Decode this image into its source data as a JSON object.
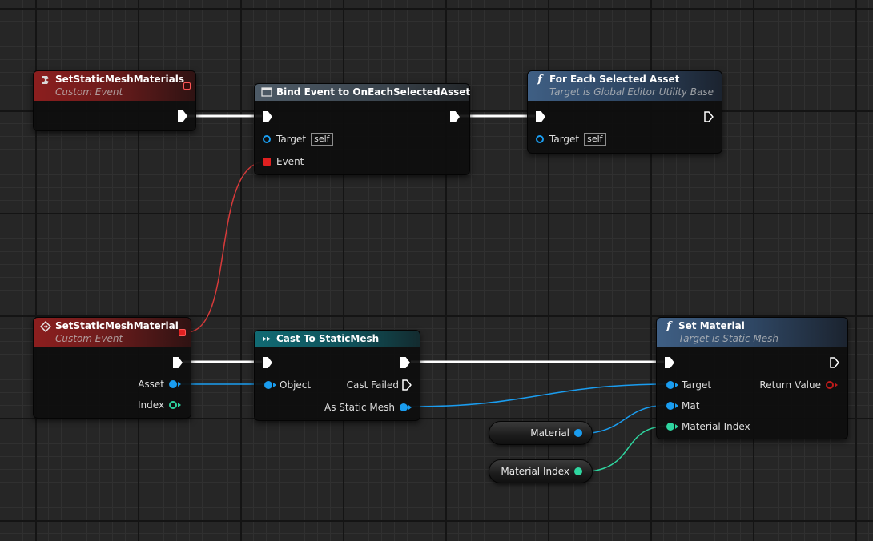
{
  "nodes": {
    "event_materials": {
      "title": "SetStaticMeshMaterials",
      "subtitle": "Custom Event",
      "icon": "custom-event-icon"
    },
    "bind_event": {
      "title": "Bind Event to OnEachSelectedAsset",
      "icon": "bind-event-icon",
      "pins": {
        "target": "Target",
        "target_default": "self",
        "event": "Event"
      }
    },
    "for_each": {
      "title": "For Each Selected Asset",
      "subtitle": "Target is Global Editor Utility Base",
      "icon": "function-icon",
      "pins": {
        "target": "Target",
        "target_default": "self"
      }
    },
    "event_material": {
      "title": "SetStaticMeshMaterial",
      "subtitle": "Custom Event",
      "icon": "custom-event-icon",
      "pins": {
        "asset": "Asset",
        "index": "Index"
      }
    },
    "cast": {
      "title": "Cast To StaticMesh",
      "icon": "cast-icon",
      "pins": {
        "object": "Object",
        "cast_failed": "Cast Failed",
        "as_static_mesh": "As Static Mesh"
      }
    },
    "set_material": {
      "title": "Set Material",
      "subtitle": "Target is Static Mesh",
      "icon": "function-icon",
      "pins": {
        "target": "Target",
        "mat": "Mat",
        "material_index": "Material Index",
        "return_value": "Return Value"
      }
    }
  },
  "variables": {
    "material": "Material",
    "material_index": "Material Index"
  },
  "colors": {
    "event_header": "#8c1e1e",
    "function_header": "#3f5f84",
    "cast_header": "#116a73",
    "object_pin": "#1a9df0",
    "integer_pin": "#2fd6a0",
    "delegate_pin": "#e02020",
    "exec": "#ffffff"
  }
}
